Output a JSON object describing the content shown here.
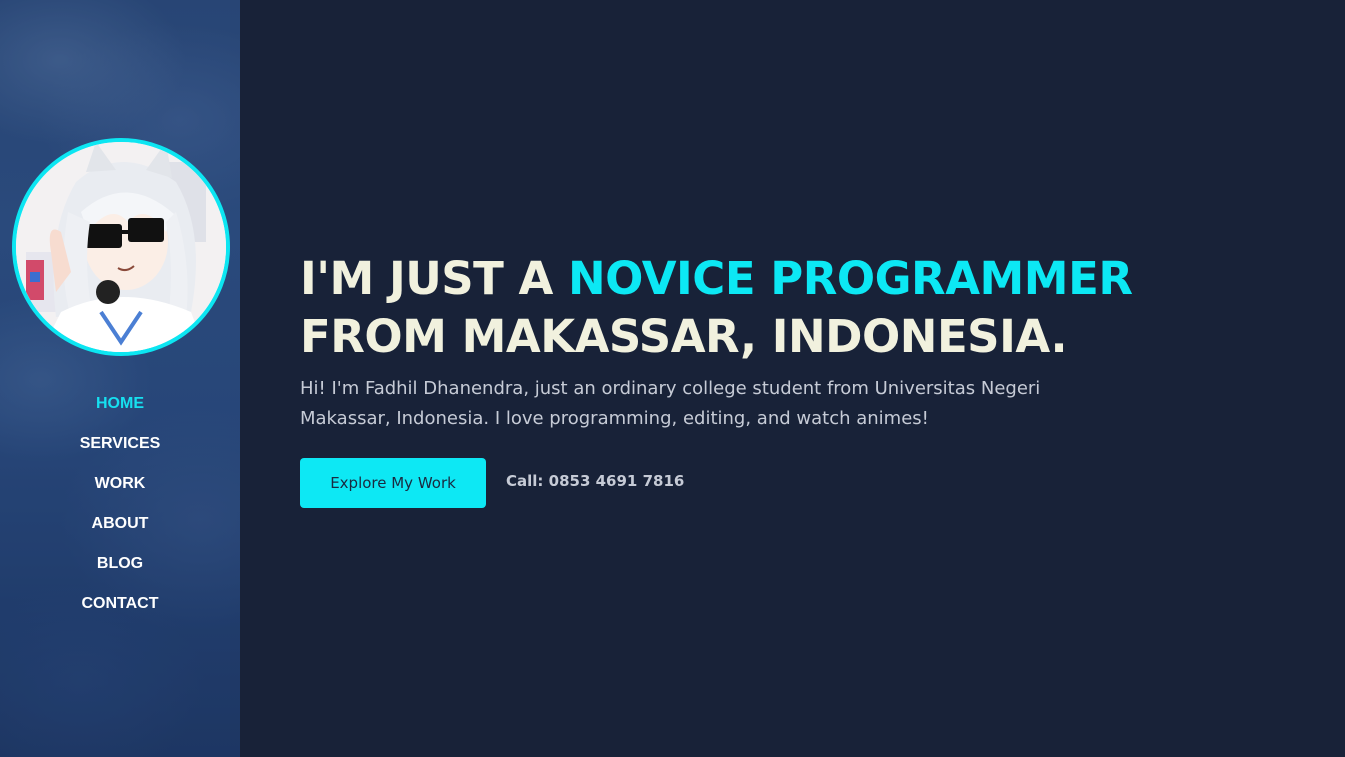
{
  "colors": {
    "background": "#182238",
    "accent": "#0ce8f4",
    "headline_text": "#f1f1de",
    "body_text": "#c6cbd6",
    "sidebar": "#2a4a7c"
  },
  "sidebar": {
    "avatar": "anime-avatar",
    "nav": [
      {
        "label": "HOME",
        "active": true
      },
      {
        "label": "SERVICES",
        "active": false
      },
      {
        "label": "WORK",
        "active": false
      },
      {
        "label": "ABOUT",
        "active": false
      },
      {
        "label": "BLOG",
        "active": false
      },
      {
        "label": "CONTACT",
        "active": false
      }
    ]
  },
  "hero": {
    "headline_part1": "I'M JUST A ",
    "headline_accent": "NOVICE PROGRAMMER",
    "headline_line2": "FROM MAKASSAR, INDONESIA.",
    "intro": "Hi! I'm Fadhil Dhanendra, just an ordinary college student from Universitas Negeri Makassar, Indonesia. I love programming, editing, and watch animes!",
    "button_label": "Explore My Work",
    "call_text": "Call: 0853 4691 7816"
  }
}
